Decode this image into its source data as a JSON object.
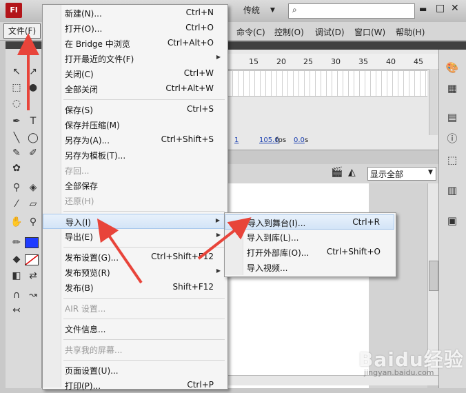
{
  "app": {
    "logo": "Fl",
    "workspace": "传统",
    "search_placeholder": "",
    "colors": {
      "stroke": "#1f3cff",
      "fill": "#ffffff",
      "menu_highlight": "#d3e4f7",
      "logo": "#b3151a"
    }
  },
  "menubar": {
    "file": "文件(F)",
    "items": [
      "命令(C)",
      "控制(O)",
      "调试(D)",
      "窗口(W)",
      "帮助(H)"
    ]
  },
  "timeline": {
    "ticks": [
      "15",
      "20",
      "25",
      "30",
      "35",
      "40",
      "45"
    ],
    "frame": "1",
    "fps_value": "105.0",
    "fps_unit": "fps",
    "seconds": "0.0",
    "seconds_unit": "s"
  },
  "stage": {
    "zoom": "显示全部"
  },
  "file_menu": [
    {
      "label": "新建(N)...",
      "shortcut": "Ctrl+N"
    },
    {
      "label": "打开(O)...",
      "shortcut": "Ctrl+O"
    },
    {
      "label": "在 Bridge 中浏览",
      "shortcut": "Ctrl+Alt+O"
    },
    {
      "label": "打开最近的文件(F)",
      "shortcut": ""
    },
    {
      "label": "关闭(C)",
      "shortcut": "Ctrl+W"
    },
    {
      "label": "全部关闭",
      "shortcut": "Ctrl+Alt+W"
    },
    {
      "label": "保存(S)",
      "shortcut": "Ctrl+S"
    },
    {
      "label": "保存并压缩(M)",
      "shortcut": ""
    },
    {
      "label": "另存为(A)...",
      "shortcut": "Ctrl+Shift+S"
    },
    {
      "label": "另存为模板(T)...",
      "shortcut": ""
    },
    {
      "label": "存回...",
      "shortcut": ""
    },
    {
      "label": "全部保存",
      "shortcut": ""
    },
    {
      "label": "还原(H)",
      "shortcut": ""
    },
    {
      "label": "导入(I)",
      "shortcut": ""
    },
    {
      "label": "导出(E)",
      "shortcut": ""
    },
    {
      "label": "发布设置(G)...",
      "shortcut": "Ctrl+Shift+F12"
    },
    {
      "label": "发布预览(R)",
      "shortcut": ""
    },
    {
      "label": "发布(B)",
      "shortcut": "Shift+F12"
    },
    {
      "label": "AIR 设置...",
      "shortcut": ""
    },
    {
      "label": "文件信息...",
      "shortcut": ""
    },
    {
      "label": "共享我的屏幕...",
      "shortcut": ""
    },
    {
      "label": "页面设置(U)...",
      "shortcut": ""
    },
    {
      "label": "打印(P)...",
      "shortcut": "Ctrl+P"
    }
  ],
  "import_submenu": [
    {
      "label": "导入到舞台(I)...",
      "shortcut": "Ctrl+R"
    },
    {
      "label": "导入到库(L)...",
      "shortcut": ""
    },
    {
      "label": "打开外部库(O)...",
      "shortcut": "Ctrl+Shift+O"
    },
    {
      "label": "导入视频...",
      "shortcut": ""
    }
  ],
  "watermark": {
    "brand": "Baidu经验",
    "url": "jingyan.baidu.com"
  }
}
